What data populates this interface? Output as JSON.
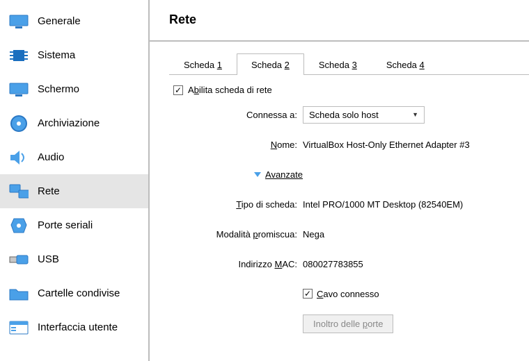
{
  "page_title": "Rete",
  "sidebar": {
    "items": [
      {
        "label": "Generale"
      },
      {
        "label": "Sistema"
      },
      {
        "label": "Schermo"
      },
      {
        "label": "Archiviazione"
      },
      {
        "label": "Audio"
      },
      {
        "label": "Rete"
      },
      {
        "label": "Porte seriali"
      },
      {
        "label": "USB"
      },
      {
        "label": "Cartelle condivise"
      },
      {
        "label": "Interfaccia utente"
      }
    ],
    "selected_index": 5
  },
  "tabs": {
    "items": [
      {
        "prefix": "Scheda ",
        "accel": "1"
      },
      {
        "prefix": "Scheda ",
        "accel": "2"
      },
      {
        "prefix": "Scheda ",
        "accel": "3"
      },
      {
        "prefix": "Scheda ",
        "accel": "4"
      }
    ],
    "active_index": 1
  },
  "form": {
    "enable_adapter": {
      "label_prefix": "A",
      "label_accel": "b",
      "label_suffix": "ilita scheda di rete",
      "checked": true
    },
    "attached_to": {
      "label": "Connessa a:",
      "value": "Scheda solo host"
    },
    "name": {
      "label_accel": "N",
      "label_suffix": "ome:",
      "value": "VirtualBox Host-Only Ethernet Adapter #3"
    },
    "advanced": {
      "label_prefix": "A",
      "label_accel": "v",
      "label_suffix": "anzate",
      "expanded": true
    },
    "adapter_type": {
      "label_accel": "T",
      "label_suffix": "ipo di scheda:",
      "value": "Intel PRO/1000 MT Desktop (82540EM)"
    },
    "promiscuous": {
      "label_prefix": "Modalità ",
      "label_accel": "p",
      "label_suffix": "romiscua:",
      "value": "Nega"
    },
    "mac": {
      "label_prefix": "Indirizzo ",
      "label_accel": "M",
      "label_suffix": "AC:",
      "value": "080027783855"
    },
    "cable": {
      "label_accel": "C",
      "label_suffix": "avo connesso",
      "checked": true
    },
    "port_forward": {
      "label_prefix": "Inoltro delle ",
      "label_accel": "p",
      "label_suffix": "orte"
    }
  }
}
